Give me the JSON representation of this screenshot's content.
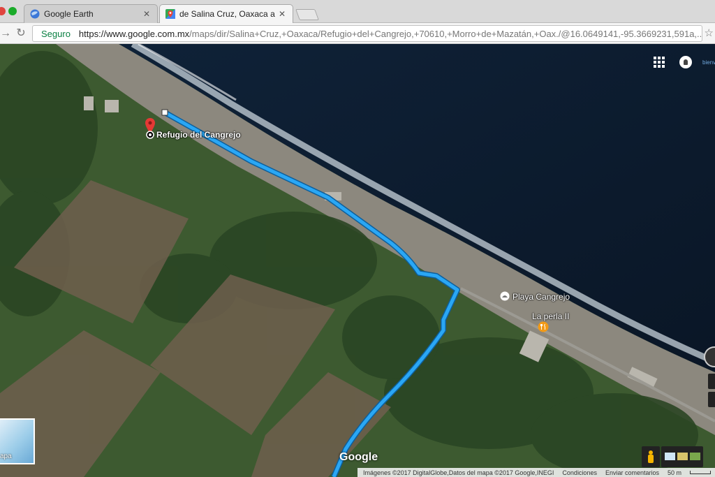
{
  "tabs": [
    {
      "title": "Google Earth",
      "close": "✕",
      "active": false
    },
    {
      "title": "de Salina Cruz, Oaxaca a Refug",
      "close": "✕",
      "active": true
    }
  ],
  "toolbar": {
    "secure_label": "Seguro",
    "url_host": "https://www.google.com.mx",
    "url_rest": "/maps/dir/Salina+Cruz,+Oaxaca/Refugio+del+Cangrejo,+70610,+Morro+de+Mazatán,+Oax./@16.0649141,-95.3669231,591a,...",
    "star_icon": "☆",
    "back_icon": "←",
    "forward_icon": "→",
    "reload_icon": "↻"
  },
  "map": {
    "place_label": "Refugio del Cangrejo",
    "beach_label": "Playa Cangrejo",
    "restaurant_label": "La perla II",
    "minimap_label": "apa",
    "logo": "Google",
    "corner_text": "bienv",
    "footer": {
      "imagery": "Imágenes ©2017 DigitalGlobe,Datos del mapa ©2017 Google,INEGI",
      "terms": "Condiciones",
      "feedback": "Enviar comentarios",
      "scale": "50 m"
    },
    "colors": {
      "route": "#2aa7f5",
      "pin": "#e53935",
      "restaurant": "#f29a16",
      "ocean": "#0d1a2c"
    }
  }
}
